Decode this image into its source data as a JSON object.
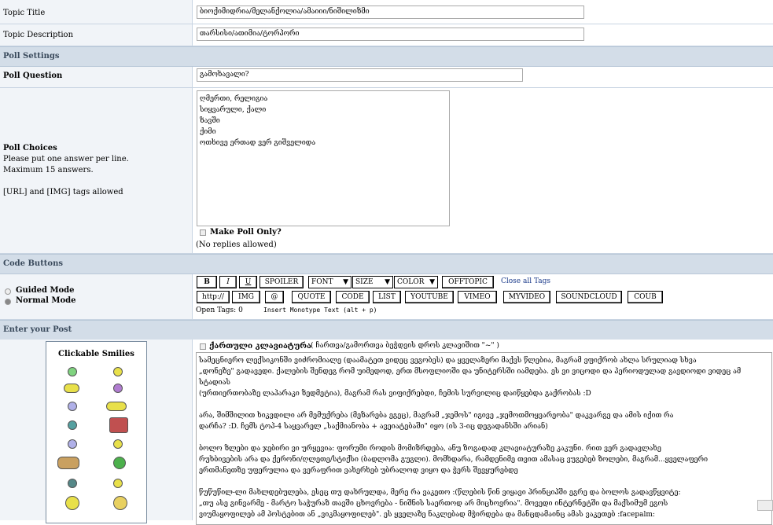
{
  "topic": {
    "title_label": "Topic Title",
    "title_value": "ბიოქიმიდრია/მელანქოლია/ამაიიი/ნიშილიზმი",
    "desc_label": "Topic Description",
    "desc_value": "თარსისი/ათიმია/ტორპორი"
  },
  "poll": {
    "section_title": "Poll Settings",
    "question_label": "Poll Question",
    "question_value": "გამოხავალი?",
    "choices_label": "Poll Choices",
    "choices_help_1": "Please put one answer per line.",
    "choices_help_2": "Maximum 15 answers.",
    "choices_help_3": "[URL] and [IMG] tags allowed",
    "choices": [
      "ღმერთი, რელიგია",
      "სიყვარული, ქალი",
      "ზავში",
      "ქიმი",
      "ოთხივე ერთად ვერ გიშველიდა"
    ],
    "make_only_label": "Make Poll Only?",
    "no_replies": "(No replies allowed)"
  },
  "code": {
    "section_title": "Code Buttons",
    "guided_mode": "Guided Mode",
    "normal_mode": "Normal Mode",
    "row1": [
      "B",
      "I",
      "U",
      "SPOILER"
    ],
    "font_select": "FONT",
    "size_select": "SIZE",
    "color_select": "COLOR",
    "offtopic": "OFFTOPIC",
    "close_all": "Close all Tags",
    "row2": [
      "http://",
      "IMG",
      "@",
      "QUOTE",
      "CODE",
      "LIST",
      "YOUTUBE",
      "VIMEO",
      "MYVIDEO",
      "SOUNDCLOUD",
      "COUB"
    ],
    "open_tags": "Open Tags: 0",
    "insert_mono": "Insert Monotype Text (alt + p)"
  },
  "post": {
    "section_title": "Enter your Post",
    "smilies_title": "Clickable Smilies",
    "keyboard_label": "ქართული კლავიატურა",
    "keyboard_hint": "( ჩართვა/გამორთვა ბეჭდვის დროს კლავიშით \"~\" )",
    "body_lines": [
      "სამეცნიერო ლექსიკონში ვიძრომიალე (დაამატეთ ვიდეც ვეგობეს) და ყველაზერი მაქვს წლებია, მაგრამ ვფიქრობ ახლა სრულიად სხვა",
      "„დონეზე\" გადავედი. ქალების შენდეგ რომ უიმედოდ, ერთ მსოფლიოში და უნიტერსში იამდება. ეს ვი ვიცოდი და პერიოდულად გავდიოდი ვიდეც ამ სტადიას",
      "(ურთიერთობაზე ლაპარაკი ზედმეტია), მაგრამ რას ვიფიქრებდი, ჩემის სურვილიც დაიწყებდა გაქრობას :D",
      "",
      "არა, შიმშილით ხიკვდილი არ მემუქრება (მეზარება ეგეც), მაგრამ „ჯემოს\" იგივე „ჯემოთმოყვარეობა\" დაკვარგე და ამის იქით რა",
      "დარჩა? :D. ჩემს ტოპ-4 საყვარელ „საქმიანობა + ავეიატებაში\" იყო (ის 3-იც დეგადანსში არიან)",
      "",
      "ბოლო ზლები და ჯებირი ვი ურყევია: ფორუმი როდის მომიზრდება, ანუ ზოგადად კლავიატურაზე კაკუნი. რით ვერ გადავლახე",
      "რუხბივების არა და ქერონი/ღლეთე/სტიქსი (ბადლომა გუგლი). მომხდარა, რამდენიმე თვით ამასაც ვუგებებ ზოლები, მაგრამ...ყველაფერი",
      "ერთმანეთზე უფერულია და ვერაფრით ვახერხებ უბრალოდ ვიყო და ჭერს შევყურებდე",
      "",
      "წუწუწილ-ლი მახლდებულება, ესეც თუ დახრულდა, მერე რა ვაკეთო :(წლების წინ ვიყავი პრინციპში ეგრე და ბოლოს გადავწყვიტე:",
      "„თუ ასე გინვარმე - მარტო საჭურაზ თავში ცხოვრება - ნიშნის საერთოდ არ მიცხოვრია\". მოვედი ინტერნეტში და მაქსიმუმ ეგოს",
      "ვიუმაყოფილებ ამ პოსტებით ან „ვიკმაყოფილებ\". ეს ყველაზე ნაკლებად მჭირდება და მანცდამაინც ამას ვაკეთებ :facepalm:"
    ]
  }
}
